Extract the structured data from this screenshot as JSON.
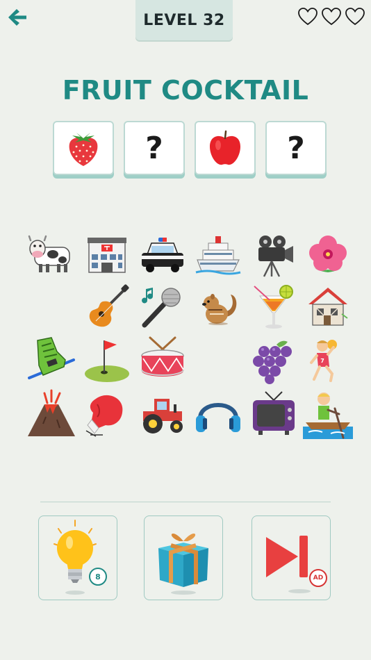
{
  "header": {
    "level_label": "LEVEL 32",
    "lives_total": 3,
    "lives_remaining": 3
  },
  "puzzle": {
    "title": "FRUIT COCKTAIL",
    "slots": [
      {
        "icon": "strawberry-icon",
        "revealed": true,
        "text": ""
      },
      {
        "icon": "question-mark",
        "revealed": false,
        "text": "?"
      },
      {
        "icon": "apple-icon",
        "revealed": true,
        "text": ""
      },
      {
        "icon": "question-mark",
        "revealed": false,
        "text": "?"
      }
    ]
  },
  "choices": [
    [
      "cow-icon",
      "post-office-icon",
      "police-car-icon",
      "cruise-ship-icon",
      "movie-camera-icon",
      "hibiscus-icon"
    ],
    [
      "",
      "guitar-icon",
      "microphone-icon",
      "chipmunk-icon",
      "tropical-drink-icon",
      "derelict-house-icon"
    ],
    [
      "ski-boot-icon",
      "golf-flag-icon",
      "drum-icon",
      "",
      "grapes-icon",
      "handball-player-icon"
    ],
    [
      "volcano-icon",
      "boxing-glove-icon",
      "tractor-icon",
      "headphones-icon",
      "television-icon",
      "rowboat-icon"
    ]
  ],
  "powerups": {
    "hint_count": "8",
    "skip_badge": "AD",
    "items": [
      "hint-lightbulb-icon",
      "gift-box-icon",
      "skip-level-icon"
    ]
  },
  "colors": {
    "background": "#eef1ec",
    "accent": "#1f8a84",
    "skip_red": "#d63434"
  }
}
